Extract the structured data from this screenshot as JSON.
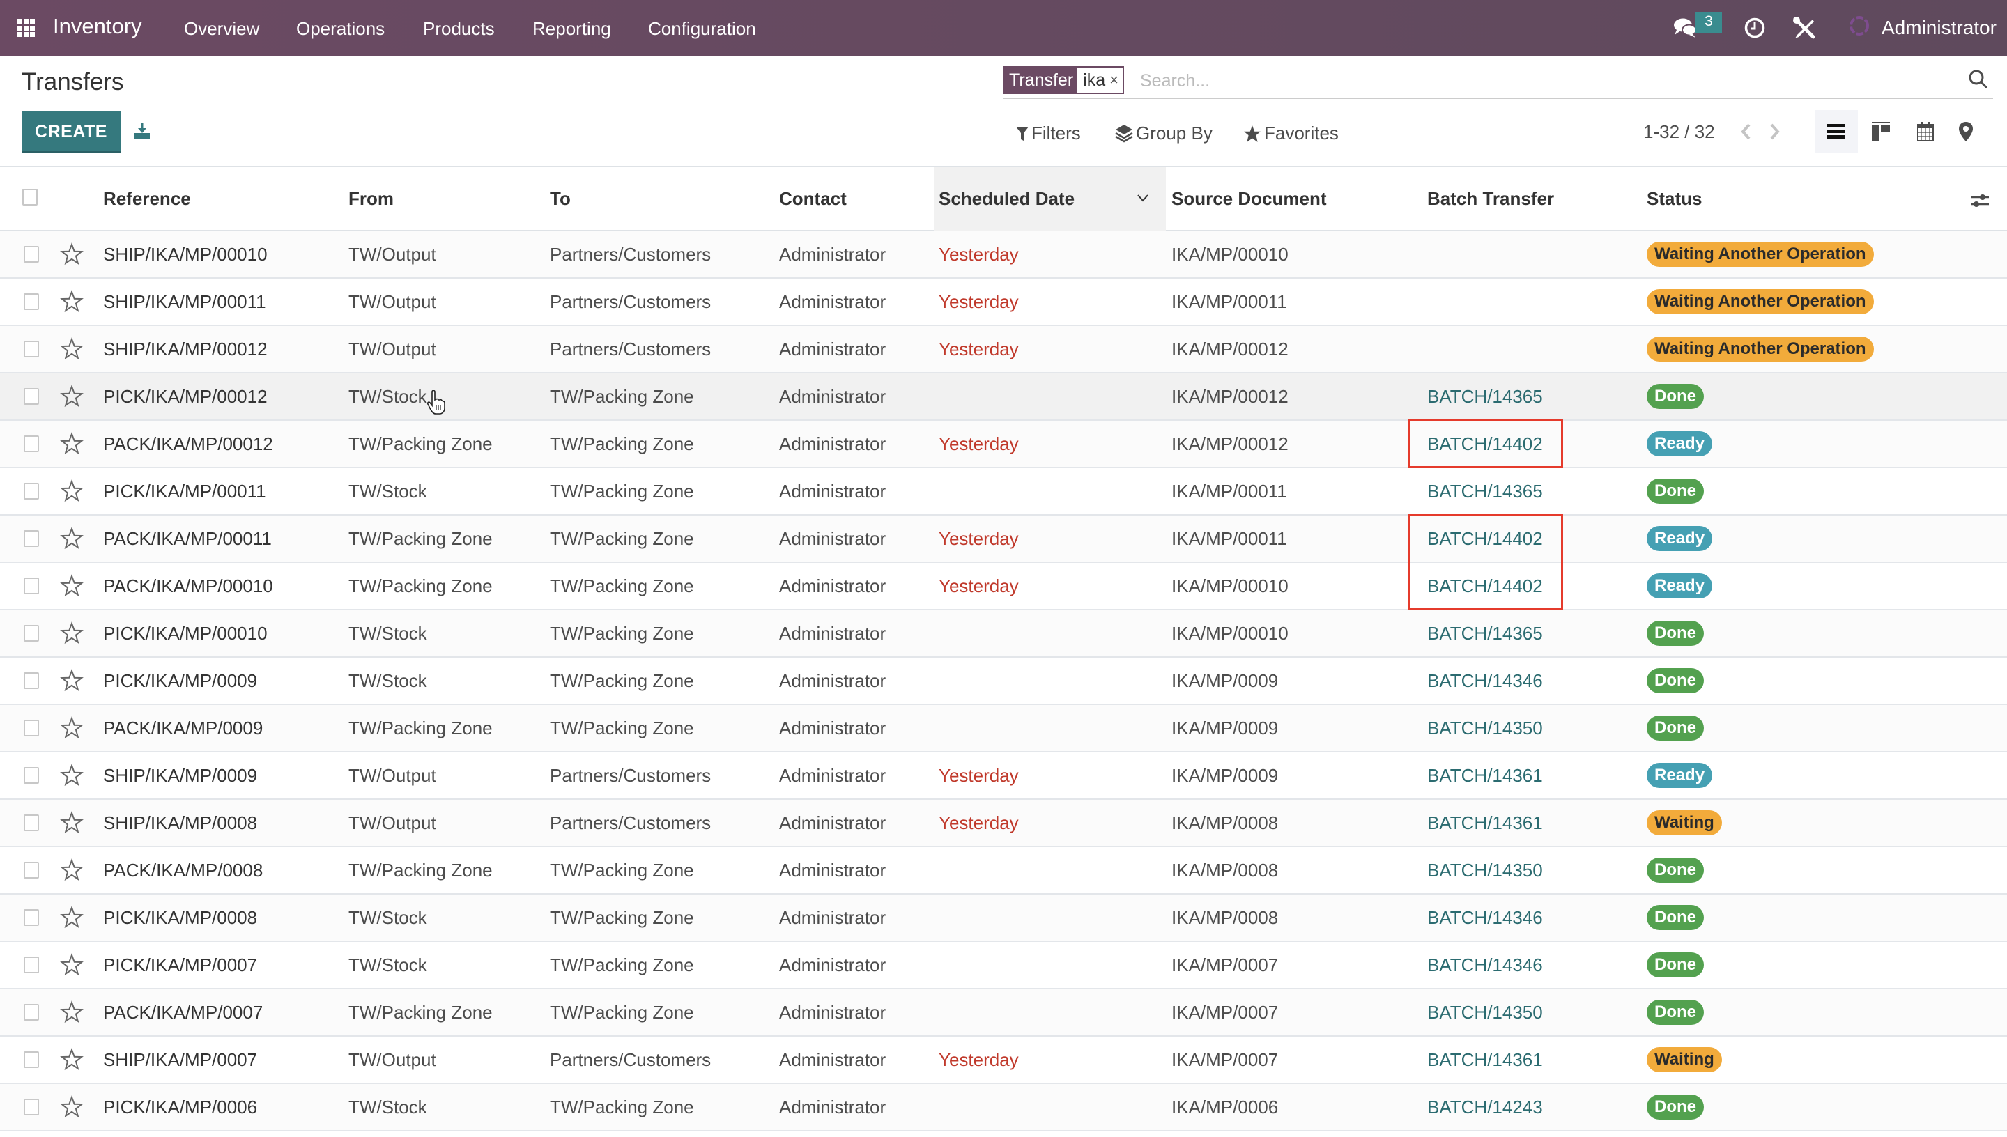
{
  "navbar": {
    "app_name": "Inventory",
    "menu": [
      "Overview",
      "Operations",
      "Products",
      "Reporting",
      "Configuration"
    ],
    "chat_count": "3",
    "user_name": "Administrator",
    "icons": [
      "apps-grid-icon",
      "chat-icon",
      "clock-icon",
      "tools-icon",
      "avatar"
    ]
  },
  "control_panel": {
    "title": "Transfers",
    "create_label": "CREATE",
    "search": {
      "facet_label": "Transfer",
      "facet_value": "ika",
      "facet_close": "×",
      "placeholder": "Search..."
    },
    "filters_label": "Filters",
    "group_by_label": "Group By",
    "favorites_label": "Favorites",
    "pager": "1-32 / 32",
    "views": [
      "list",
      "kanban",
      "calendar",
      "map"
    ],
    "active_view": "list"
  },
  "table": {
    "columns": [
      "Reference",
      "From",
      "To",
      "Contact",
      "Scheduled Date",
      "Source Document",
      "Batch Transfer",
      "Status"
    ],
    "sorted_column": "Scheduled Date",
    "rows": [
      {
        "ref": "SHIP/IKA/MP/00010",
        "from": "TW/Output",
        "to": "Partners/Customers",
        "contact": "Administrator",
        "date": "Yesterday",
        "source": "IKA/MP/00010",
        "batch": "",
        "status": "Waiting Another Operation",
        "status_kind": "waiting"
      },
      {
        "ref": "SHIP/IKA/MP/00011",
        "from": "TW/Output",
        "to": "Partners/Customers",
        "contact": "Administrator",
        "date": "Yesterday",
        "source": "IKA/MP/00011",
        "batch": "",
        "status": "Waiting Another Operation",
        "status_kind": "waiting"
      },
      {
        "ref": "SHIP/IKA/MP/00012",
        "from": "TW/Output",
        "to": "Partners/Customers",
        "contact": "Administrator",
        "date": "Yesterday",
        "source": "IKA/MP/00012",
        "batch": "",
        "status": "Waiting Another Operation",
        "status_kind": "waiting"
      },
      {
        "ref": "PICK/IKA/MP/00012",
        "from": "TW/Stock",
        "to": "TW/Packing Zone",
        "contact": "Administrator",
        "date": "",
        "source": "IKA/MP/00012",
        "batch": "BATCH/14365",
        "status": "Done",
        "status_kind": "done"
      },
      {
        "ref": "PACK/IKA/MP/00012",
        "from": "TW/Packing Zone",
        "to": "TW/Packing Zone",
        "contact": "Administrator",
        "date": "Yesterday",
        "source": "IKA/MP/00012",
        "batch": "BATCH/14402",
        "status": "Ready",
        "status_kind": "ready"
      },
      {
        "ref": "PICK/IKA/MP/00011",
        "from": "TW/Stock",
        "to": "TW/Packing Zone",
        "contact": "Administrator",
        "date": "",
        "source": "IKA/MP/00011",
        "batch": "BATCH/14365",
        "status": "Done",
        "status_kind": "done"
      },
      {
        "ref": "PACK/IKA/MP/00011",
        "from": "TW/Packing Zone",
        "to": "TW/Packing Zone",
        "contact": "Administrator",
        "date": "Yesterday",
        "source": "IKA/MP/00011",
        "batch": "BATCH/14402",
        "status": "Ready",
        "status_kind": "ready"
      },
      {
        "ref": "PACK/IKA/MP/00010",
        "from": "TW/Packing Zone",
        "to": "TW/Packing Zone",
        "contact": "Administrator",
        "date": "Yesterday",
        "source": "IKA/MP/00010",
        "batch": "BATCH/14402",
        "status": "Ready",
        "status_kind": "ready"
      },
      {
        "ref": "PICK/IKA/MP/00010",
        "from": "TW/Stock",
        "to": "TW/Packing Zone",
        "contact": "Administrator",
        "date": "",
        "source": "IKA/MP/00010",
        "batch": "BATCH/14365",
        "status": "Done",
        "status_kind": "done"
      },
      {
        "ref": "PICK/IKA/MP/0009",
        "from": "TW/Stock",
        "to": "TW/Packing Zone",
        "contact": "Administrator",
        "date": "",
        "source": "IKA/MP/0009",
        "batch": "BATCH/14346",
        "status": "Done",
        "status_kind": "done"
      },
      {
        "ref": "PACK/IKA/MP/0009",
        "from": "TW/Packing Zone",
        "to": "TW/Packing Zone",
        "contact": "Administrator",
        "date": "",
        "source": "IKA/MP/0009",
        "batch": "BATCH/14350",
        "status": "Done",
        "status_kind": "done"
      },
      {
        "ref": "SHIP/IKA/MP/0009",
        "from": "TW/Output",
        "to": "Partners/Customers",
        "contact": "Administrator",
        "date": "Yesterday",
        "source": "IKA/MP/0009",
        "batch": "BATCH/14361",
        "status": "Ready",
        "status_kind": "ready"
      },
      {
        "ref": "SHIP/IKA/MP/0008",
        "from": "TW/Output",
        "to": "Partners/Customers",
        "contact": "Administrator",
        "date": "Yesterday",
        "source": "IKA/MP/0008",
        "batch": "BATCH/14361",
        "status": "Waiting",
        "status_kind": "waiting"
      },
      {
        "ref": "PACK/IKA/MP/0008",
        "from": "TW/Packing Zone",
        "to": "TW/Packing Zone",
        "contact": "Administrator",
        "date": "",
        "source": "IKA/MP/0008",
        "batch": "BATCH/14350",
        "status": "Done",
        "status_kind": "done"
      },
      {
        "ref": "PICK/IKA/MP/0008",
        "from": "TW/Stock",
        "to": "TW/Packing Zone",
        "contact": "Administrator",
        "date": "",
        "source": "IKA/MP/0008",
        "batch": "BATCH/14346",
        "status": "Done",
        "status_kind": "done"
      },
      {
        "ref": "PICK/IKA/MP/0007",
        "from": "TW/Stock",
        "to": "TW/Packing Zone",
        "contact": "Administrator",
        "date": "",
        "source": "IKA/MP/0007",
        "batch": "BATCH/14346",
        "status": "Done",
        "status_kind": "done"
      },
      {
        "ref": "PACK/IKA/MP/0007",
        "from": "TW/Packing Zone",
        "to": "TW/Packing Zone",
        "contact": "Administrator",
        "date": "",
        "source": "IKA/MP/0007",
        "batch": "BATCH/14350",
        "status": "Done",
        "status_kind": "done"
      },
      {
        "ref": "SHIP/IKA/MP/0007",
        "from": "TW/Output",
        "to": "Partners/Customers",
        "contact": "Administrator",
        "date": "Yesterday",
        "source": "IKA/MP/0007",
        "batch": "BATCH/14361",
        "status": "Waiting",
        "status_kind": "waiting"
      },
      {
        "ref": "PICK/IKA/MP/0006",
        "from": "TW/Stock",
        "to": "TW/Packing Zone",
        "contact": "Administrator",
        "date": "",
        "source": "IKA/MP/0006",
        "batch": "BATCH/14243",
        "status": "Done",
        "status_kind": "done"
      }
    ],
    "hovered_row": 3,
    "highlighted_batch_rows": [
      [
        4
      ],
      [
        6,
        7
      ]
    ]
  },
  "colors": {
    "navbar": "#684a60",
    "primary_button": "#35797e",
    "date_overdue": "#c0392b",
    "link": "#2b6b70",
    "status_waiting": "#f2ab3b",
    "status_done": "#53a14f",
    "status_ready": "#45a0b3",
    "annotation_box": "#e53b2c"
  }
}
